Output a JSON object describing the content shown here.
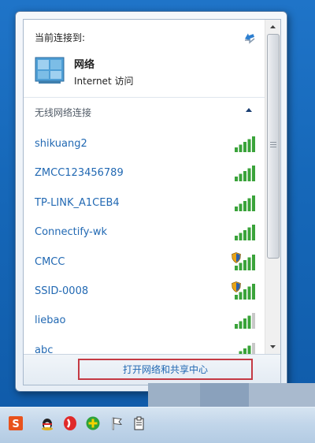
{
  "current_connection": {
    "label": "当前连接到:",
    "network_name": "网络",
    "status": "Internet 访问"
  },
  "wireless_section": {
    "title": "无线网络连接",
    "networks": [
      {
        "ssid": "shikuang2",
        "signal": 5,
        "secured": false
      },
      {
        "ssid": "ZMCC123456789",
        "signal": 5,
        "secured": false
      },
      {
        "ssid": "TP-LINK_A1CEB4",
        "signal": 5,
        "secured": false
      },
      {
        "ssid": "Connectify-wk",
        "signal": 5,
        "secured": false
      },
      {
        "ssid": "CMCC",
        "signal": 5,
        "secured": true
      },
      {
        "ssid": "SSID-0008",
        "signal": 5,
        "secured": true
      },
      {
        "ssid": "liebao",
        "signal": 4,
        "secured": false
      },
      {
        "ssid": "abc",
        "signal": 4,
        "secured": false
      }
    ]
  },
  "footer": {
    "open_center_label": "打开网络和共享中心"
  },
  "colors": {
    "link": "#2269b3",
    "signal_on": "#3aa33a",
    "signal_off": "#c8c8c8",
    "highlight_border": "#c43a44"
  },
  "taskbar": {
    "tray_icons": [
      "sogou-input-icon",
      "qq-penguin-icon",
      "antivirus-icon",
      "security-guard-icon",
      "action-center-flag-icon",
      "clipboard-icon"
    ]
  }
}
